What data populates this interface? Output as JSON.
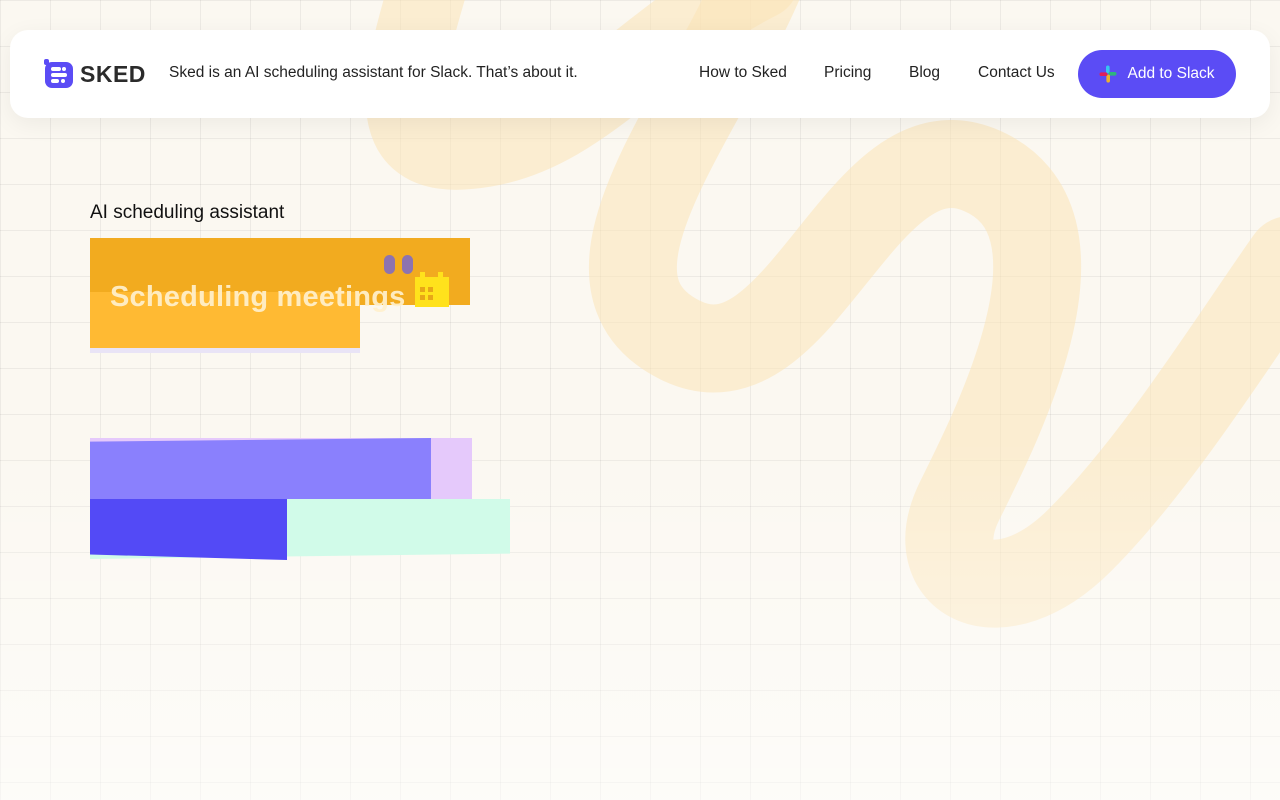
{
  "header": {
    "brand": "SKED",
    "tagline": "Sked is an AI scheduling assistant for Slack. That’s about it.",
    "nav": {
      "how_to": "How to Sked",
      "pricing": "Pricing",
      "blog": "Blog",
      "contact": "Contact Us"
    },
    "cta_label": "Add to Slack"
  },
  "hero": {
    "eyebrow": "AI scheduling assistant",
    "headline": "Scheduling meetings"
  },
  "colors": {
    "accent": "#5b4cf5",
    "orange": "#f6b22d",
    "lavender": "#e5c9fb",
    "mint": "#cffbe8",
    "background": "#fbf8f1"
  },
  "icons": {
    "logo": "sked-logo-icon",
    "slack": "slack-icon",
    "calendar": "calendar-icon",
    "eyes": "eyes-icon"
  }
}
